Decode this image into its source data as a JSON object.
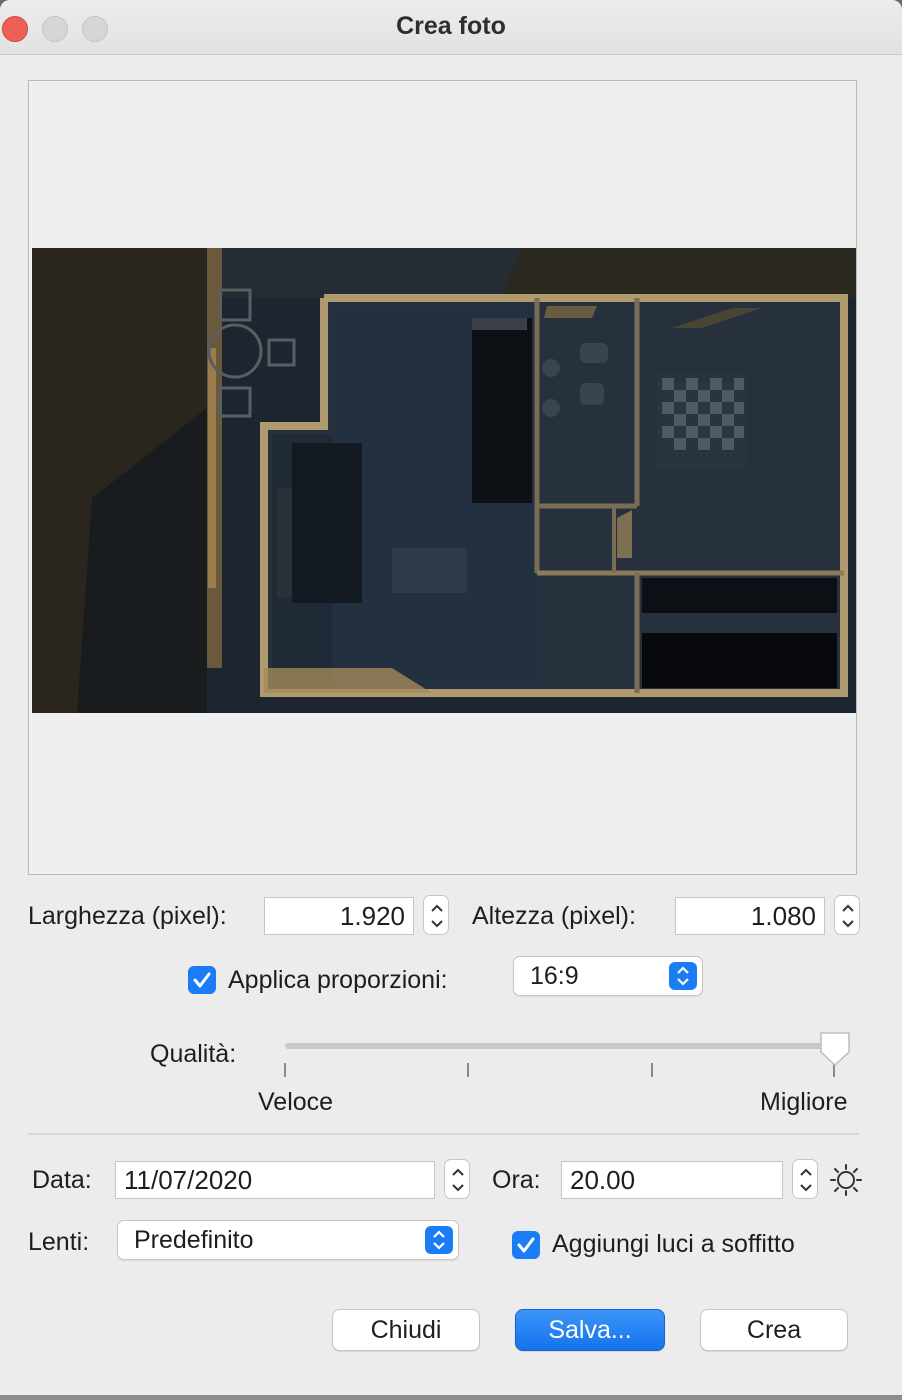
{
  "window": {
    "title": "Crea foto"
  },
  "size": {
    "width_label": "Larghezza (pixel):",
    "width_value": "1.920",
    "height_label": "Altezza (pixel):",
    "height_value": "1.080"
  },
  "proportions": {
    "checkbox_label": "Applica proporzioni:",
    "checked": true,
    "selected": "16:9"
  },
  "quality": {
    "label": "Qualità:",
    "min_label": "Veloce",
    "max_label": "Migliore",
    "level": 4,
    "levels": 4
  },
  "date": {
    "label": "Data:",
    "value": "11/07/2020"
  },
  "time": {
    "label": "Ora:",
    "value": "20.00"
  },
  "lens": {
    "label": "Lenti:",
    "selected": "Predefinito"
  },
  "ceiling_lights": {
    "label": "Aggiungi luci a soffitto",
    "checked": true
  },
  "buttons": {
    "close": "Chiudi",
    "save": "Salva...",
    "create": "Crea"
  },
  "colors": {
    "accent": "#1a7df5",
    "close_light": "#ee5f57"
  },
  "icons": {
    "sun": "sun-icon"
  }
}
